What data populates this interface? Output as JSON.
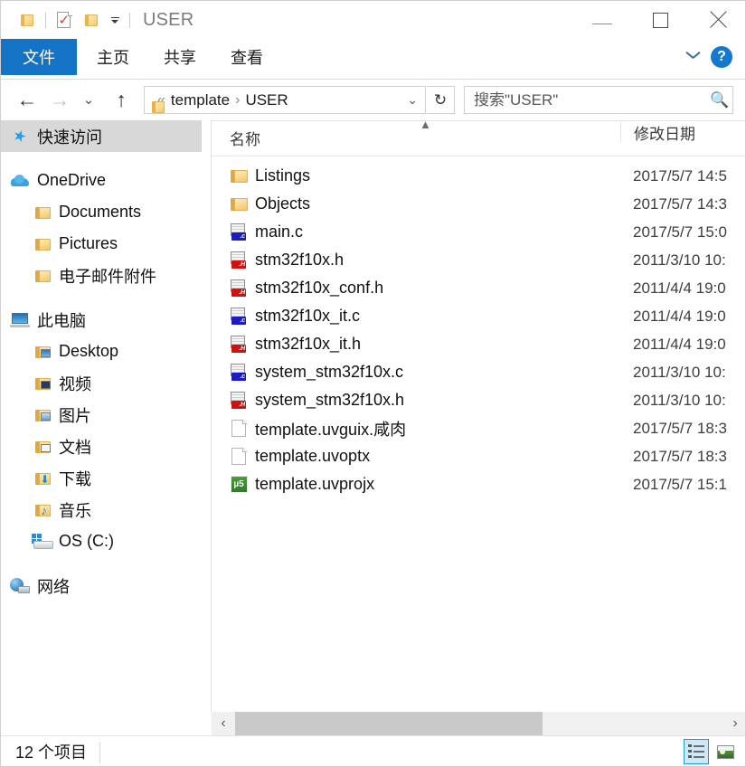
{
  "window": {
    "title": "USER",
    "quick_access": [
      {
        "name": "folder-icon",
        "label": "folder"
      },
      {
        "name": "properties-icon",
        "label": "properties"
      },
      {
        "name": "new-folder-icon",
        "label": "new folder"
      },
      {
        "name": "customize-qat-icon",
        "label": "customize"
      }
    ],
    "controls": {
      "minimize": "minimize",
      "maximize": "maximize",
      "close": "close"
    }
  },
  "ribbon": {
    "tabs": [
      {
        "label": "文件",
        "active": true
      },
      {
        "label": "主页",
        "active": false
      },
      {
        "label": "共享",
        "active": false
      },
      {
        "label": "查看",
        "active": false
      }
    ],
    "collapse_label": "collapse-ribbon",
    "help_label": "?"
  },
  "address": {
    "back": "←",
    "forward": "→",
    "history": "⌄",
    "up": "↑",
    "crumb_prefix": "«",
    "crumbs": [
      "template",
      "USER"
    ],
    "crumb_separator": "›",
    "dropdown": "⌄",
    "refresh": "↻"
  },
  "search": {
    "placeholder": "搜索\"USER\"",
    "value": "",
    "icon": "search-icon"
  },
  "sidebar": {
    "items": [
      {
        "label": "快速访问",
        "icon": "star-icon",
        "level": 0,
        "selected": true,
        "gap_before": false
      },
      {
        "label": "OneDrive",
        "icon": "cloud-icon",
        "level": 0,
        "selected": false,
        "gap_before": true
      },
      {
        "label": "Documents",
        "icon": "folder-icon",
        "level": 1,
        "selected": false,
        "gap_before": false
      },
      {
        "label": "Pictures",
        "icon": "folder-icon",
        "level": 1,
        "selected": false,
        "gap_before": false
      },
      {
        "label": "电子邮件附件",
        "icon": "folder-icon",
        "level": 1,
        "selected": false,
        "gap_before": false
      },
      {
        "label": "此电脑",
        "icon": "pc-icon",
        "level": 0,
        "selected": false,
        "gap_before": true
      },
      {
        "label": "Desktop",
        "icon": "desktop-folder-icon",
        "level": 1,
        "selected": false,
        "gap_before": false
      },
      {
        "label": "视频",
        "icon": "videos-folder-icon",
        "level": 1,
        "selected": false,
        "gap_before": false
      },
      {
        "label": "图片",
        "icon": "pictures-folder-icon",
        "level": 1,
        "selected": false,
        "gap_before": false
      },
      {
        "label": "文档",
        "icon": "documents-folder-icon",
        "level": 1,
        "selected": false,
        "gap_before": false
      },
      {
        "label": "下载",
        "icon": "downloads-folder-icon",
        "level": 1,
        "selected": false,
        "gap_before": false
      },
      {
        "label": "音乐",
        "icon": "music-folder-icon",
        "level": 1,
        "selected": false,
        "gap_before": false
      },
      {
        "label": "OS (C:)",
        "icon": "drive-icon",
        "level": 1,
        "selected": false,
        "gap_before": false
      },
      {
        "label": "网络",
        "icon": "network-icon",
        "level": 0,
        "selected": false,
        "gap_before": true
      }
    ]
  },
  "filelist": {
    "columns": [
      {
        "key": "name",
        "label": "名称",
        "sorted": "asc"
      },
      {
        "key": "date",
        "label": "修改日期",
        "sorted": null
      }
    ],
    "rows": [
      {
        "name": "Listings",
        "icon": "folder-icon",
        "date": "2017/5/7 14:5"
      },
      {
        "name": "Objects",
        "icon": "folder-icon",
        "date": "2017/5/7 14:3"
      },
      {
        "name": "main.c",
        "icon": "c-source-icon",
        "date": "2017/5/7 15:0"
      },
      {
        "name": "stm32f10x.h",
        "icon": "h-header-icon",
        "date": "2011/3/10 10:"
      },
      {
        "name": "stm32f10x_conf.h",
        "icon": "h-header-icon",
        "date": "2011/4/4 19:0"
      },
      {
        "name": "stm32f10x_it.c",
        "icon": "c-source-icon",
        "date": "2011/4/4 19:0"
      },
      {
        "name": "stm32f10x_it.h",
        "icon": "h-header-icon",
        "date": "2011/4/4 19:0"
      },
      {
        "name": "system_stm32f10x.c",
        "icon": "c-source-icon",
        "date": "2011/3/10 10:"
      },
      {
        "name": "system_stm32f10x.h",
        "icon": "h-header-icon",
        "date": "2011/3/10 10:"
      },
      {
        "name": "template.uvguix.咸肉",
        "icon": "blank-file-icon",
        "date": "2017/5/7 18:3"
      },
      {
        "name": "template.uvoptx",
        "icon": "blank-file-icon",
        "date": "2017/5/7 18:3"
      },
      {
        "name": "template.uvprojx",
        "icon": "keil-project-icon",
        "date": "2017/5/7 15:1"
      }
    ],
    "badge_c": ".c",
    "badge_h": ".H",
    "keil_glyph": "µ5"
  },
  "scrollbar": {
    "left_arrow": "‹",
    "right_arrow": "›"
  },
  "status": {
    "item_count": "12 个项目",
    "views": [
      {
        "name": "details-view-button",
        "active": true
      },
      {
        "name": "large-icons-view-button",
        "active": false
      }
    ]
  },
  "colors": {
    "accent": "#1573c6",
    "help_blue": "#1478cd",
    "selection_gray": "#d8d8d8",
    "active_view_bg": "#cfe8f7",
    "active_view_border": "#2596d4"
  }
}
